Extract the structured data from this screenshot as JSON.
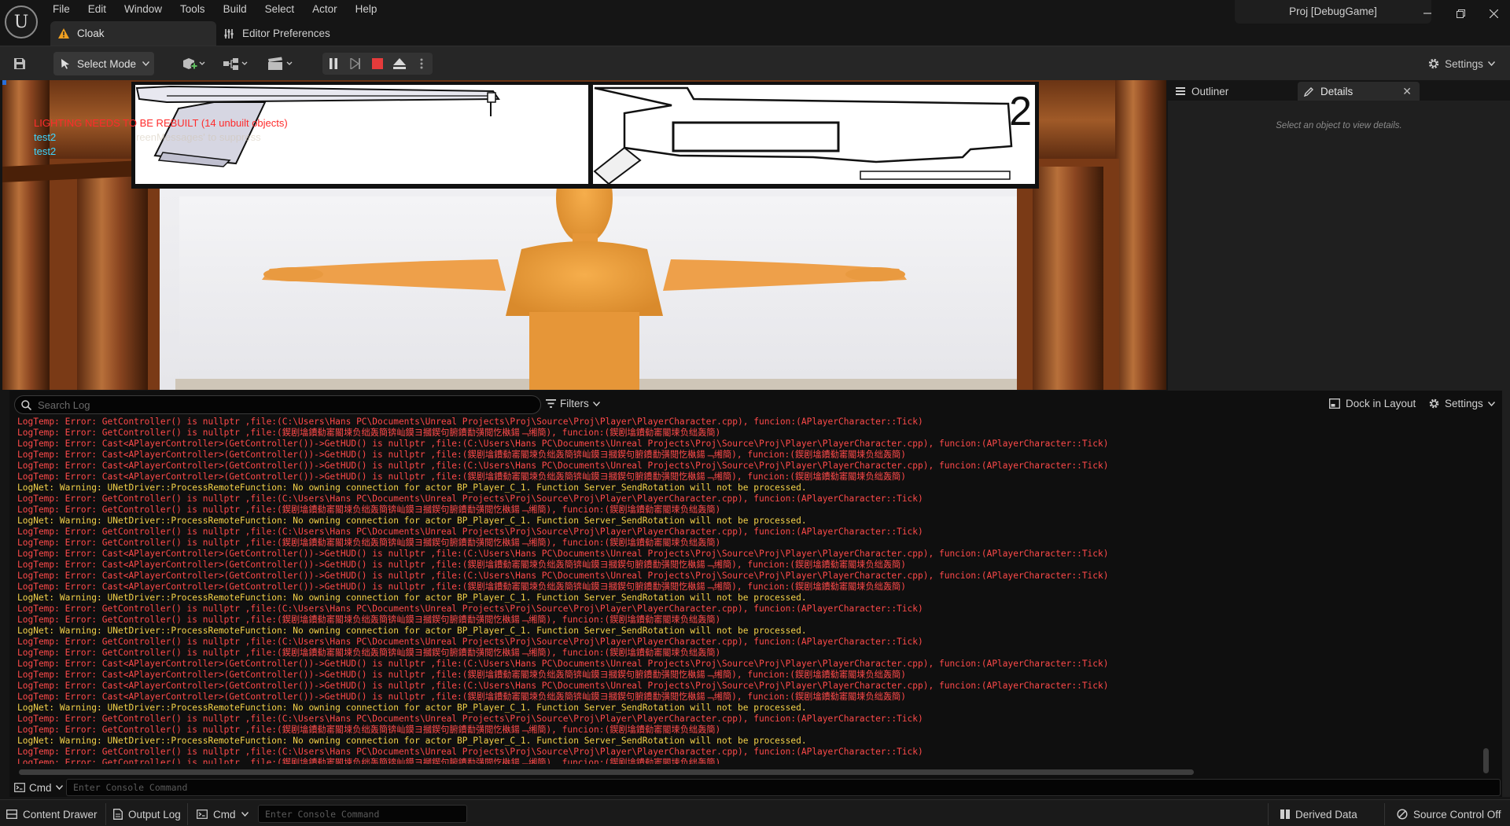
{
  "menu": {
    "items": [
      "File",
      "Edit",
      "Window",
      "Tools",
      "Build",
      "Select",
      "Actor",
      "Help"
    ]
  },
  "tabs": {
    "level": "Cloak",
    "editor_preferences": "Editor Preferences"
  },
  "project": {
    "name": "Proj [DebugGame]"
  },
  "toolbar": {
    "select_mode": "Select Mode",
    "settings": "Settings"
  },
  "viewport": {
    "lighting_warning": "LIGHTING NEEDS TO BE REBUILT (14 unbuilt objects)",
    "hidden_hint": "reenMessages' to suppress",
    "debug_messages": [
      "test2",
      "test2"
    ],
    "hud_slot_number": "2"
  },
  "right_panel": {
    "outliner_tab": "Outliner",
    "details_tab": "Details",
    "details_empty": "Select an object to view details."
  },
  "log": {
    "search_placeholder": "Search Log",
    "filters": "Filters",
    "dock_in_layout": "Dock in Layout",
    "settings": "Settings",
    "cmd_label": "Cmd",
    "console_placeholder": "Enter Console Command",
    "lines": [
      {
        "level": "error",
        "text": "LogTemp: Error: GetController() is nullptr ,file:(C:\\Users\\Hans PC\\Documents\\Unreal Projects\\Proj\\Source\\Proj\\Player\\PlayerCharacter.cpp), funcion:(APlayerCharacter::Tick)"
      },
      {
        "level": "error",
        "text": "LogTemp: Error: GetController() is nullptr ,file:(鍥剧墖鐨勬寚閽堜负绌轰簡锛屾鏌ヨ摑鍥句腑鐨勫彉閲忔槸鍚﹁缃簡), funcion:(鍥剧墖鐨勬寚閽堜负绌轰簡)"
      },
      {
        "level": "error",
        "text": "LogTemp: Error: Cast<APlayerController>(GetController())->GetHUD() is nullptr ,file:(C:\\Users\\Hans PC\\Documents\\Unreal Projects\\Proj\\Source\\Proj\\Player\\PlayerCharacter.cpp), funcion:(APlayerCharacter::Tick)"
      },
      {
        "level": "error",
        "text": "LogTemp: Error: Cast<APlayerController>(GetController())->GetHUD() is nullptr ,file:(鍥剧墖鐨勬寚閽堜负绌轰簡锛屾鏌ヨ摑鍥句腑鐨勫彉閲忔槸鍚﹁缃簡), funcion:(鍥剧墖鐨勬寚閽堜负绌轰簡)"
      },
      {
        "level": "error",
        "text": "LogTemp: Error: Cast<APlayerController>(GetController())->GetHUD() is nullptr ,file:(C:\\Users\\Hans PC\\Documents\\Unreal Projects\\Proj\\Source\\Proj\\Player\\PlayerCharacter.cpp), funcion:(APlayerCharacter::Tick)"
      },
      {
        "level": "error",
        "text": "LogTemp: Error: Cast<APlayerController>(GetController())->GetHUD() is nullptr ,file:(鍥剧墖鐨勬寚閽堜负绌轰簡锛屾鏌ヨ摑鍥句腑鐨勫彉閲忔槸鍚﹁缃簡), funcion:(鍥剧墖鐨勬寚閽堜负绌轰簡)"
      },
      {
        "level": "warn",
        "text": "LogNet: Warning: UNetDriver::ProcessRemoteFunction: No owning connection for actor BP_Player_C_1. Function Server_SendRotation will not be processed."
      },
      {
        "level": "error",
        "text": "LogTemp: Error: GetController() is nullptr ,file:(C:\\Users\\Hans PC\\Documents\\Unreal Projects\\Proj\\Source\\Proj\\Player\\PlayerCharacter.cpp), funcion:(APlayerCharacter::Tick)"
      },
      {
        "level": "error",
        "text": "LogTemp: Error: GetController() is nullptr ,file:(鍥剧墖鐨勬寚閽堜负绌轰簡锛屾鏌ヨ摑鍥句腑鐨勫彉閲忔槸鍚﹁缃簡), funcion:(鍥剧墖鐨勬寚閽堜负绌轰簡)"
      },
      {
        "level": "warn",
        "text": "LogNet: Warning: UNetDriver::ProcessRemoteFunction: No owning connection for actor BP_Player_C_1. Function Server_SendRotation will not be processed."
      },
      {
        "level": "error",
        "text": "LogTemp: Error: GetController() is nullptr ,file:(C:\\Users\\Hans PC\\Documents\\Unreal Projects\\Proj\\Source\\Proj\\Player\\PlayerCharacter.cpp), funcion:(APlayerCharacter::Tick)"
      },
      {
        "level": "error",
        "text": "LogTemp: Error: GetController() is nullptr ,file:(鍥剧墖鐨勬寚閽堜负绌轰簡锛屾鏌ヨ摑鍥句腑鐨勫彉閲忔槸鍚﹁缃簡), funcion:(鍥剧墖鐨勬寚閽堜负绌轰簡)"
      },
      {
        "level": "error",
        "text": "LogTemp: Error: Cast<APlayerController>(GetController())->GetHUD() is nullptr ,file:(C:\\Users\\Hans PC\\Documents\\Unreal Projects\\Proj\\Source\\Proj\\Player\\PlayerCharacter.cpp), funcion:(APlayerCharacter::Tick)"
      },
      {
        "level": "error",
        "text": "LogTemp: Error: Cast<APlayerController>(GetController())->GetHUD() is nullptr ,file:(鍥剧墖鐨勬寚閽堜负绌轰簡锛屾鏌ヨ摑鍥句腑鐨勫彉閲忔槸鍚﹁缃簡), funcion:(鍥剧墖鐨勬寚閽堜负绌轰簡)"
      },
      {
        "level": "error",
        "text": "LogTemp: Error: Cast<APlayerController>(GetController())->GetHUD() is nullptr ,file:(C:\\Users\\Hans PC\\Documents\\Unreal Projects\\Proj\\Source\\Proj\\Player\\PlayerCharacter.cpp), funcion:(APlayerCharacter::Tick)"
      },
      {
        "level": "error",
        "text": "LogTemp: Error: Cast<APlayerController>(GetController())->GetHUD() is nullptr ,file:(鍥剧墖鐨勬寚閽堜负绌轰簡锛屾鏌ヨ摑鍥句腑鐨勫彉閲忔槸鍚﹁缃簡), funcion:(鍥剧墖鐨勬寚閽堜负绌轰簡)"
      },
      {
        "level": "warn",
        "text": "LogNet: Warning: UNetDriver::ProcessRemoteFunction: No owning connection for actor BP_Player_C_1. Function Server_SendRotation will not be processed."
      },
      {
        "level": "error",
        "text": "LogTemp: Error: GetController() is nullptr ,file:(C:\\Users\\Hans PC\\Documents\\Unreal Projects\\Proj\\Source\\Proj\\Player\\PlayerCharacter.cpp), funcion:(APlayerCharacter::Tick)"
      },
      {
        "level": "error",
        "text": "LogTemp: Error: GetController() is nullptr ,file:(鍥剧墖鐨勬寚閽堜负绌轰簡锛屾鏌ヨ摑鍥句腑鐨勫彉閲忔槸鍚﹁缃簡), funcion:(鍥剧墖鐨勬寚閽堜负绌轰簡)"
      },
      {
        "level": "warn",
        "text": "LogNet: Warning: UNetDriver::ProcessRemoteFunction: No owning connection for actor BP_Player_C_1. Function Server_SendRotation will not be processed."
      },
      {
        "level": "error",
        "text": "LogTemp: Error: GetController() is nullptr ,file:(C:\\Users\\Hans PC\\Documents\\Unreal Projects\\Proj\\Source\\Proj\\Player\\PlayerCharacter.cpp), funcion:(APlayerCharacter::Tick)"
      },
      {
        "level": "error",
        "text": "LogTemp: Error: GetController() is nullptr ,file:(鍥剧墖鐨勬寚閽堜负绌轰簡锛屾鏌ヨ摑鍥句腑鐨勫彉閲忔槸鍚﹁缃簡), funcion:(鍥剧墖鐨勬寚閽堜负绌轰簡)"
      },
      {
        "level": "error",
        "text": "LogTemp: Error: Cast<APlayerController>(GetController())->GetHUD() is nullptr ,file:(C:\\Users\\Hans PC\\Documents\\Unreal Projects\\Proj\\Source\\Proj\\Player\\PlayerCharacter.cpp), funcion:(APlayerCharacter::Tick)"
      },
      {
        "level": "error",
        "text": "LogTemp: Error: Cast<APlayerController>(GetController())->GetHUD() is nullptr ,file:(鍥剧墖鐨勬寚閽堜负绌轰簡锛屾鏌ヨ摑鍥句腑鐨勫彉閲忔槸鍚﹁缃簡), funcion:(鍥剧墖鐨勬寚閽堜负绌轰簡)"
      },
      {
        "level": "error",
        "text": "LogTemp: Error: Cast<APlayerController>(GetController())->GetHUD() is nullptr ,file:(C:\\Users\\Hans PC\\Documents\\Unreal Projects\\Proj\\Source\\Proj\\Player\\PlayerCharacter.cpp), funcion:(APlayerCharacter::Tick)"
      },
      {
        "level": "error",
        "text": "LogTemp: Error: Cast<APlayerController>(GetController())->GetHUD() is nullptr ,file:(鍥剧墖鐨勬寚閽堜负绌轰簡锛屾鏌ヨ摑鍥句腑鐨勫彉閲忔槸鍚﹁缃簡), funcion:(鍥剧墖鐨勬寚閽堜负绌轰簡)"
      },
      {
        "level": "warn",
        "text": "LogNet: Warning: UNetDriver::ProcessRemoteFunction: No owning connection for actor BP_Player_C_1. Function Server_SendRotation will not be processed."
      },
      {
        "level": "error",
        "text": "LogTemp: Error: GetController() is nullptr ,file:(C:\\Users\\Hans PC\\Documents\\Unreal Projects\\Proj\\Source\\Proj\\Player\\PlayerCharacter.cpp), funcion:(APlayerCharacter::Tick)"
      },
      {
        "level": "error",
        "text": "LogTemp: Error: GetController() is nullptr ,file:(鍥剧墖鐨勬寚閽堜负绌轰簡锛屾鏌ヨ摑鍥句腑鐨勫彉閲忔槸鍚﹁缃簡), funcion:(鍥剧墖鐨勬寚閽堜负绌轰簡)"
      },
      {
        "level": "warn",
        "text": "LogNet: Warning: UNetDriver::ProcessRemoteFunction: No owning connection for actor BP_Player_C_1. Function Server_SendRotation will not be processed."
      },
      {
        "level": "error",
        "text": "LogTemp: Error: GetController() is nullptr ,file:(C:\\Users\\Hans PC\\Documents\\Unreal Projects\\Proj\\Source\\Proj\\Player\\PlayerCharacter.cpp), funcion:(APlayerCharacter::Tick)"
      },
      {
        "level": "error",
        "text": "LogTemp: Error: GetController() is nullptr ,file:(鍥剧墖鐨勬寚閽堜负绌轰簡锛屾鏌ヨ摑鍥句腑鐨勫彉閲忔槸鍚﹁缃簡), funcion:(鍥剧墖鐨勬寚閽堜负绌轰簡)"
      }
    ]
  },
  "statusbar": {
    "content_drawer": "Content Drawer",
    "output_log": "Output Log",
    "cmd_label": "Cmd",
    "console_placeholder": "Enter Console Command",
    "derived_data": "Derived Data",
    "source_control": "Source Control Off"
  },
  "colors": {
    "error": "#ff4a4a",
    "warning": "#f5d34a",
    "debug_message": "#3ed6ff",
    "lighting_warning": "#ff2b2b",
    "stop_button": "#e53b3b",
    "character": "#f0a040"
  }
}
